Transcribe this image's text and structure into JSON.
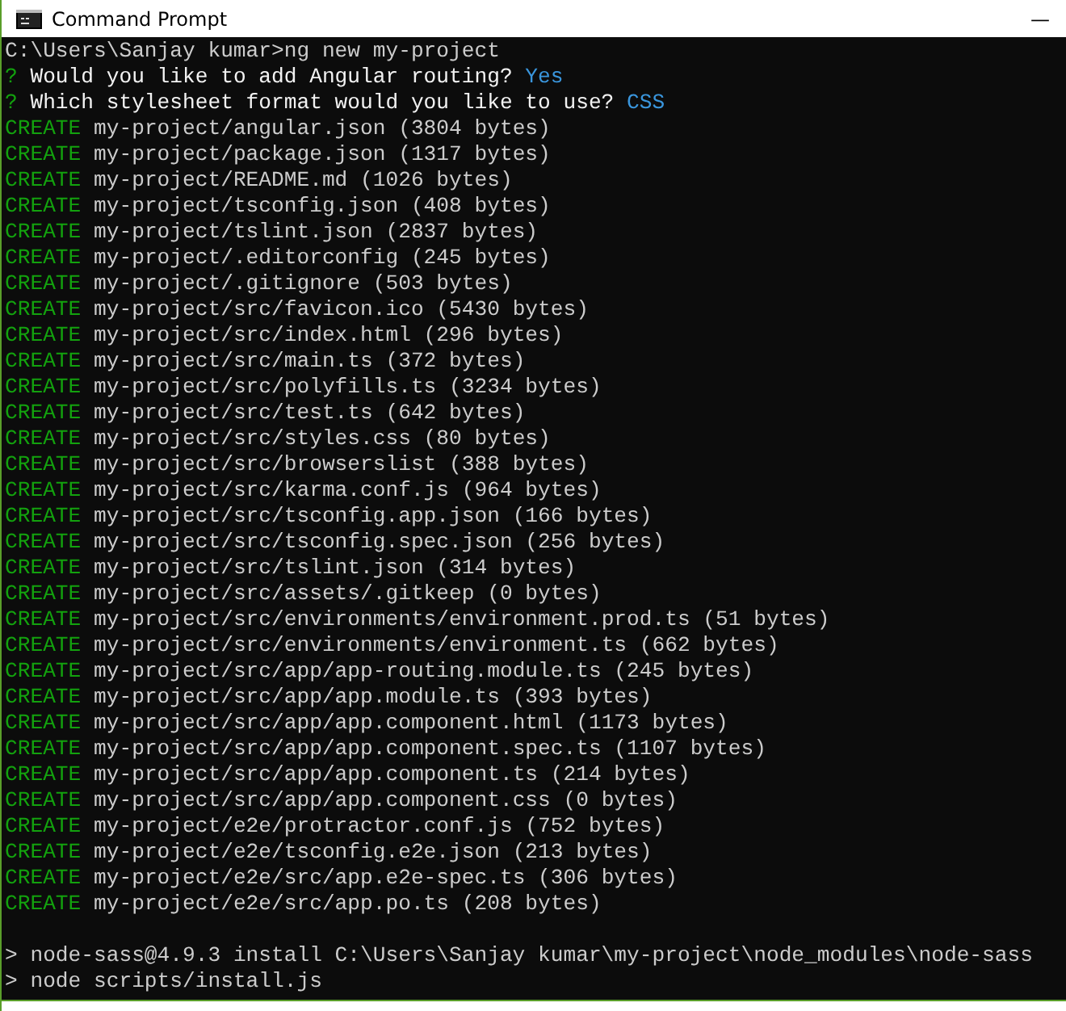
{
  "window": {
    "title": "Command Prompt",
    "minimize": "—"
  },
  "lines": [
    {
      "kind": "command",
      "text": "C:\\Users\\Sanjay kumar>ng new my-project"
    },
    {
      "kind": "question",
      "prefix": "?",
      "text": "Would you like to add Angular routing?",
      "answer": "Yes"
    },
    {
      "kind": "question",
      "prefix": "?",
      "text": "Which stylesheet format would you like to use?",
      "answer": "CSS"
    },
    {
      "kind": "create",
      "prefix": "CREATE",
      "text": "my-project/angular.json (3804 bytes)"
    },
    {
      "kind": "create",
      "prefix": "CREATE",
      "text": "my-project/package.json (1317 bytes)"
    },
    {
      "kind": "create",
      "prefix": "CREATE",
      "text": "my-project/README.md (1026 bytes)"
    },
    {
      "kind": "create",
      "prefix": "CREATE",
      "text": "my-project/tsconfig.json (408 bytes)"
    },
    {
      "kind": "create",
      "prefix": "CREATE",
      "text": "my-project/tslint.json (2837 bytes)"
    },
    {
      "kind": "create",
      "prefix": "CREATE",
      "text": "my-project/.editorconfig (245 bytes)"
    },
    {
      "kind": "create",
      "prefix": "CREATE",
      "text": "my-project/.gitignore (503 bytes)"
    },
    {
      "kind": "create",
      "prefix": "CREATE",
      "text": "my-project/src/favicon.ico (5430 bytes)"
    },
    {
      "kind": "create",
      "prefix": "CREATE",
      "text": "my-project/src/index.html (296 bytes)"
    },
    {
      "kind": "create",
      "prefix": "CREATE",
      "text": "my-project/src/main.ts (372 bytes)"
    },
    {
      "kind": "create",
      "prefix": "CREATE",
      "text": "my-project/src/polyfills.ts (3234 bytes)"
    },
    {
      "kind": "create",
      "prefix": "CREATE",
      "text": "my-project/src/test.ts (642 bytes)"
    },
    {
      "kind": "create",
      "prefix": "CREATE",
      "text": "my-project/src/styles.css (80 bytes)"
    },
    {
      "kind": "create",
      "prefix": "CREATE",
      "text": "my-project/src/browserslist (388 bytes)"
    },
    {
      "kind": "create",
      "prefix": "CREATE",
      "text": "my-project/src/karma.conf.js (964 bytes)"
    },
    {
      "kind": "create",
      "prefix": "CREATE",
      "text": "my-project/src/tsconfig.app.json (166 bytes)"
    },
    {
      "kind": "create",
      "prefix": "CREATE",
      "text": "my-project/src/tsconfig.spec.json (256 bytes)"
    },
    {
      "kind": "create",
      "prefix": "CREATE",
      "text": "my-project/src/tslint.json (314 bytes)"
    },
    {
      "kind": "create",
      "prefix": "CREATE",
      "text": "my-project/src/assets/.gitkeep (0 bytes)"
    },
    {
      "kind": "create",
      "prefix": "CREATE",
      "text": "my-project/src/environments/environment.prod.ts (51 bytes)"
    },
    {
      "kind": "create",
      "prefix": "CREATE",
      "text": "my-project/src/environments/environment.ts (662 bytes)"
    },
    {
      "kind": "create",
      "prefix": "CREATE",
      "text": "my-project/src/app/app-routing.module.ts (245 bytes)"
    },
    {
      "kind": "create",
      "prefix": "CREATE",
      "text": "my-project/src/app/app.module.ts (393 bytes)"
    },
    {
      "kind": "create",
      "prefix": "CREATE",
      "text": "my-project/src/app/app.component.html (1173 bytes)"
    },
    {
      "kind": "create",
      "prefix": "CREATE",
      "text": "my-project/src/app/app.component.spec.ts (1107 bytes)"
    },
    {
      "kind": "create",
      "prefix": "CREATE",
      "text": "my-project/src/app/app.component.ts (214 bytes)"
    },
    {
      "kind": "create",
      "prefix": "CREATE",
      "text": "my-project/src/app/app.component.css (0 bytes)"
    },
    {
      "kind": "create",
      "prefix": "CREATE",
      "text": "my-project/e2e/protractor.conf.js (752 bytes)"
    },
    {
      "kind": "create",
      "prefix": "CREATE",
      "text": "my-project/e2e/tsconfig.e2e.json (213 bytes)"
    },
    {
      "kind": "create",
      "prefix": "CREATE",
      "text": "my-project/e2e/src/app.e2e-spec.ts (306 bytes)"
    },
    {
      "kind": "create",
      "prefix": "CREATE",
      "text": "my-project/e2e/src/app.po.ts (208 bytes)"
    },
    {
      "kind": "blank"
    },
    {
      "kind": "output",
      "prefix": ">",
      "text": "node-sass@4.9.3 install C:\\Users\\Sanjay kumar\\my-project\\node_modules\\node-sass"
    },
    {
      "kind": "output",
      "prefix": ">",
      "text": "node scripts/install.js"
    }
  ]
}
